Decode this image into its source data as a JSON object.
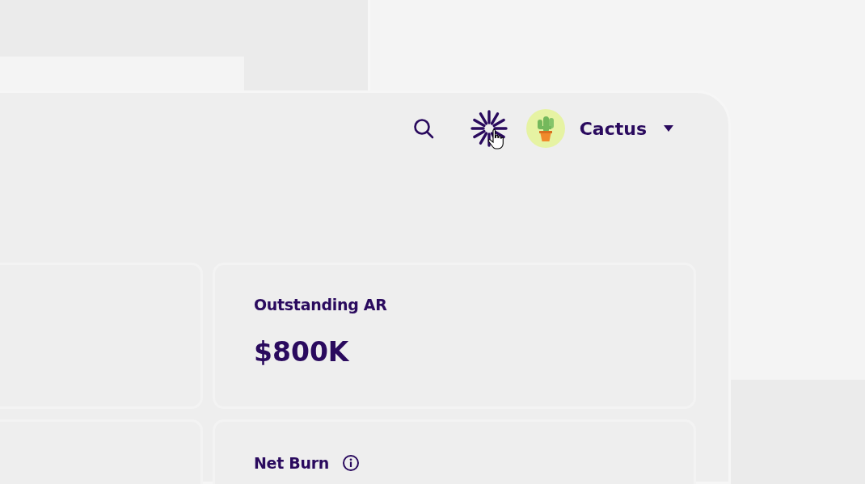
{
  "header": {
    "user_name": "Cactus"
  },
  "cards": [
    {
      "label": "Outstanding AR",
      "value": "$800K",
      "info": false
    },
    {
      "label": "Net Burn",
      "info": true
    }
  ]
}
